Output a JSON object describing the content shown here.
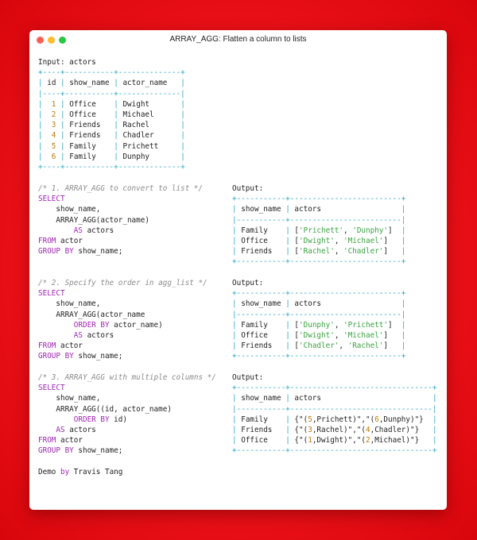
{
  "window": {
    "title": "ARRAY_AGG: Flatten a column to lists"
  },
  "input": {
    "label": "Input: actors",
    "table_name": "actors",
    "columns": [
      "id",
      "show_name",
      "actor_name"
    ],
    "rows": [
      {
        "id": "1",
        "show_name": "Office",
        "actor_name": "Dwight"
      },
      {
        "id": "2",
        "show_name": "Office",
        "actor_name": "Michael"
      },
      {
        "id": "3",
        "show_name": "Friends",
        "actor_name": "Rachel"
      },
      {
        "id": "4",
        "show_name": "Friends",
        "actor_name": "Chadler"
      },
      {
        "id": "5",
        "show_name": "Family",
        "actor_name": "Prichett"
      },
      {
        "id": "6",
        "show_name": "Family",
        "actor_name": "Dunphy"
      }
    ]
  },
  "queries": [
    {
      "comment": "/* 1. ARRAY_AGG to convert to list */",
      "code": [
        "SELECT",
        "    show_name,",
        "    ARRAY_AGG(actor_name)",
        "        AS actors",
        "FROM actor",
        "GROUP BY show_name;"
      ],
      "output_label": "Output:",
      "columns": [
        "show_name",
        "actors"
      ],
      "rows": [
        {
          "show_name": "Family",
          "actors": "['Prichett', 'Dunphy']"
        },
        {
          "show_name": "Office",
          "actors": "['Dwight', 'Michael']"
        },
        {
          "show_name": "Friends",
          "actors": "['Rachel', 'Chadler']"
        }
      ]
    },
    {
      "comment": "/* 2. Specify the order in agg_list */",
      "code": [
        "SELECT",
        "    show_name,",
        "    ARRAY_AGG(actor_name",
        "        ORDER BY actor_name)",
        "        AS actors",
        "FROM actor",
        "GROUP BY show_name;"
      ],
      "output_label": "Output:",
      "columns": [
        "show_name",
        "actors"
      ],
      "rows": [
        {
          "show_name": "Family",
          "actors": "['Dunphy', 'Prichett']"
        },
        {
          "show_name": "Office",
          "actors": "['Dwight', 'Michael']"
        },
        {
          "show_name": "Friends",
          "actors": "['Chadler', 'Rachel']"
        }
      ]
    },
    {
      "comment": "/* 3. ARRAY_AGG with multiple columns */",
      "code": [
        "SELECT",
        "    show_name,",
        "    ARRAY_AGG((id, actor_name)",
        "        ORDER BY id)",
        "    AS actors",
        "FROM actor",
        "GROUP BY show_name;"
      ],
      "output_label": "Output:",
      "columns": [
        "show_name",
        "actors"
      ],
      "rows": [
        {
          "show_name": "Family",
          "actors": "{\"(5,Prichett)\",\"(6,Dunphy)\"}"
        },
        {
          "show_name": "Friends",
          "actors": "{\"(3,Rachel)\",\"(4,Chadler)\"}"
        },
        {
          "show_name": "Office",
          "actors": "{\"(1,Dwight)\",\"(2,Michael)\"}"
        }
      ]
    }
  ],
  "footer": "Demo by Travis Tang",
  "colors": {
    "background": "#ee1219",
    "window": "#ffffff",
    "border": "#2aa7c6",
    "keyword": "#a024b5",
    "string": "#3aa342",
    "number": "#c07a00",
    "comment": "#8b8b8b",
    "dot_close": "#ff5f57",
    "dot_minimize": "#febc2e",
    "dot_zoom": "#28c840"
  }
}
